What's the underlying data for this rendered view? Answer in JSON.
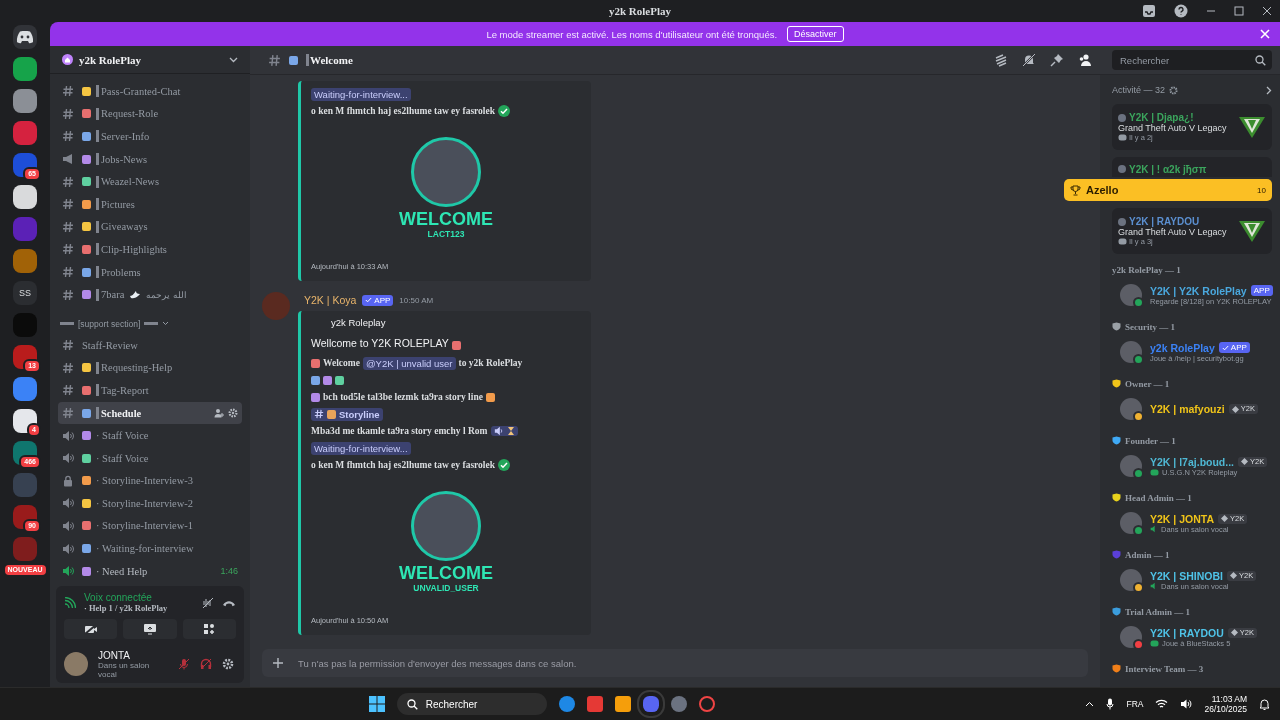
{
  "window": {
    "title": "y2k RolePlay"
  },
  "servers": [
    {
      "kind": "home"
    },
    {
      "kind": "server",
      "color": "#16a34a"
    },
    {
      "kind": "server",
      "color": "#8b8f96"
    },
    {
      "kind": "server",
      "color": "#d5223f"
    },
    {
      "kind": "server",
      "color": "#1d4ed8",
      "badge": "65"
    },
    {
      "kind": "server",
      "color": "#d9dadc"
    },
    {
      "kind": "server",
      "color": "#5b21b6"
    },
    {
      "kind": "server",
      "color": "#a16207"
    },
    {
      "kind": "server",
      "color": "#2b2d31",
      "label": "SS"
    },
    {
      "kind": "server",
      "color": "#0b0b0b"
    },
    {
      "kind": "server",
      "color": "#b91c1c",
      "badge": "13"
    },
    {
      "kind": "server",
      "color": "#3b82f6"
    },
    {
      "kind": "server",
      "color": "#e5e7eb",
      "badge": "4"
    },
    {
      "kind": "server",
      "color": "#0f766e",
      "badge": "466"
    },
    {
      "kind": "server",
      "color": "#374151"
    },
    {
      "kind": "server",
      "color": "#991b1b",
      "badge": "90"
    },
    {
      "kind": "server",
      "color": "#7f1d1d",
      "badge": "NOUVEAU"
    }
  ],
  "banner": {
    "text": "Le mode streamer est activé. Les noms d'utilisateur ont été tronqués.",
    "button": "Désactiver"
  },
  "server_header": {
    "name": "y2k RolePlay"
  },
  "channels": [
    {
      "kind": "text",
      "name": "Pass-Granted-Chat",
      "selected": false
    },
    {
      "kind": "text",
      "name": "Request-Role",
      "selected": false
    },
    {
      "kind": "text",
      "name": "Server-Info",
      "selected": false
    },
    {
      "kind": "announce",
      "name": "Jobs-News",
      "selected": false
    },
    {
      "kind": "text",
      "name": "Weazel-News",
      "selected": false
    },
    {
      "kind": "text",
      "name": "Pictures",
      "selected": false
    },
    {
      "kind": "text",
      "name": "Giveaways",
      "selected": false
    },
    {
      "kind": "text",
      "name": "Clip-Highlights",
      "selected": false
    },
    {
      "kind": "text",
      "name": "Problems",
      "selected": false
    },
    {
      "kind": "text",
      "name": "7bara",
      "suffix": "الله يرحمه",
      "selected": false
    },
    {
      "kind": "category",
      "name": "[support section]"
    },
    {
      "kind": "plain",
      "name": "Staff-Review",
      "selected": false
    },
    {
      "kind": "text",
      "name": "Requesting-Help",
      "selected": false
    },
    {
      "kind": "text",
      "name": "Tag-Report",
      "selected": false
    },
    {
      "kind": "text",
      "name": "Schedule",
      "selected": true
    },
    {
      "kind": "voice",
      "name": "· Staff Voice",
      "selected": false
    },
    {
      "kind": "voice",
      "name": "· Staff Voice",
      "selected": false
    },
    {
      "kind": "locked",
      "name": "· Storyline-Interview-3",
      "selected": false
    },
    {
      "kind": "voice",
      "name": "· Storyline-Interview-2",
      "selected": false
    },
    {
      "kind": "voice",
      "name": "· Storyline-Interview-1",
      "selected": false
    },
    {
      "kind": "voice",
      "name": "· Waiting-for-interview",
      "selected": false
    },
    {
      "kind": "voice-live",
      "name": "· Need Help",
      "timer": "1:46",
      "selected": false
    }
  ],
  "voice_panel": {
    "status": "Voix connectée",
    "channel": "· Help 1 / y2k RolePlay"
  },
  "user_panel": {
    "name": "JONTA",
    "status": "Dans un salon vocal"
  },
  "chat_header": {
    "channel": "Welcome",
    "search_placeholder": "Rechercher"
  },
  "messages": [
    {
      "embed": {
        "lines": [
          [
            {
              "kind": "chip",
              "text": "Waiting-for-interview..."
            }
          ],
          [
            {
              "kind": "text",
              "text": "o ken M fhmtch haj es2lhume taw ey fasrolek"
            },
            {
              "kind": "check"
            }
          ]
        ],
        "image": {
          "title": "WELCOME",
          "subtitle": "LACT123"
        },
        "timestamp": "Aujourd'hui à 10:33 AM"
      }
    },
    {
      "author": "Y2K | Koya",
      "badge": "APP",
      "time": "10:50 AM",
      "embed": {
        "author": "y2k Roleplay",
        "lines": [
          [
            {
              "kind": "title",
              "text": "Wellcome to Y2K ROLEPLAY"
            },
            {
              "kind": "emoji"
            }
          ],
          [
            {
              "kind": "emoji"
            },
            {
              "kind": "text",
              "text": "Welcome"
            },
            {
              "kind": "chip",
              "text": "@Y2K | unvalid user"
            },
            {
              "kind": "text",
              "text": "to y2k RolePlay"
            }
          ],
          [
            {
              "kind": "emoji"
            },
            {
              "kind": "emoji"
            },
            {
              "kind": "emoji"
            }
          ],
          [
            {
              "kind": "emoji"
            },
            {
              "kind": "text",
              "text": "bch tod5le tal3be lezmk ta9ra story line"
            },
            {
              "kind": "emoji"
            }
          ],
          [
            {
              "kind": "channel",
              "text": "Storyline"
            }
          ],
          [
            {
              "kind": "text",
              "text": "Mba3d me tkamle ta9ra story emchy l Rom"
            },
            {
              "kind": "voice-chip"
            }
          ],
          [
            {
              "kind": "chip",
              "text": "Waiting-for-interview..."
            }
          ],
          [
            {
              "kind": "text",
              "text": "o ken M fhmtch haj es2lhume taw ey fasrolek"
            },
            {
              "kind": "check"
            }
          ]
        ],
        "image": {
          "title": "WELCOME",
          "subtitle": "UNVALID_USER"
        },
        "timestamp": "Aujourd'hui à 10:50 AM"
      }
    }
  ],
  "composer": {
    "placeholder": "Tu n'as pas la permission d'envoyer des messages dans ce salon."
  },
  "members": {
    "activity_title": "Activité — 32",
    "activities": [
      {
        "user": "Y2K | Djapa¿!",
        "color": "#3ba55d",
        "game": "Grand Theft Auto V Legacy",
        "time": "Il y a 2j"
      },
      {
        "user": "Y2K | ! α2k jђσπ",
        "color": "#3ba55d"
      },
      {
        "user": "Y2K | RAYDOU",
        "color": "#5b8fd0",
        "game": "Grand Theft Auto V Legacy",
        "time": "Il y a 3j"
      }
    ],
    "groups": [
      {
        "name": "y2k RolePlay — 1",
        "members": [
          {
            "name": "Y2K | Y2K RolePlay",
            "color": "#4aa8de",
            "badge": {
              "kind": "app",
              "text": "APP"
            },
            "status": {
              "kind": "plain",
              "text": "Regarde [8/128] on Y2K ROLEPLAY"
            },
            "presence": {
              "color": "#23a55a"
            }
          }
        ]
      },
      {
        "name": "Security — 1",
        "color": "#9aa0a6",
        "members": [
          {
            "name": "y2k RolePlay",
            "color": "#3b82f6",
            "badge": {
              "kind": "verified",
              "text": "APP"
            },
            "status": {
              "kind": "plain",
              "text": "Joue à /help | securitybot.gg"
            },
            "presence": {
              "color": "#23a55a"
            }
          }
        ]
      },
      {
        "name": "Owner — 1",
        "color": "#f0c419",
        "members": [
          {
            "name": "Y2K | mafyouzi",
            "color": "#f0c419",
            "badge": {
              "kind": "tag",
              "text": "Y2K"
            },
            "presence": {
              "color": "#f0b232"
            }
          }
        ]
      },
      {
        "name": "Founder — 1",
        "color": "#3fa9f5",
        "members": [
          {
            "name": "Y2K | l7aj.boud...",
            "color": "#4fb8d4",
            "badge": {
              "kind": "tag",
              "text": "Y2K"
            },
            "status": {
              "kind": "game",
              "text": "U.S.G.N Y2K Roleplay"
            },
            "presence": {
              "color": "#23a55a"
            }
          }
        ]
      },
      {
        "name": "Head Admin — 1",
        "color": "#e8d21c",
        "members": [
          {
            "name": "Y2K | JONTA",
            "color": "#f0c419",
            "badge": {
              "kind": "tag",
              "text": "Y2K"
            },
            "status": {
              "kind": "voice",
              "text": "Dans un salon vocal"
            },
            "presence": {
              "color": "#23a55a"
            }
          }
        ]
      },
      {
        "name": "Admin — 1",
        "color": "#5b3fd8",
        "members": [
          {
            "name": "Y2K | SHINOBI",
            "color": "#4fc3e8",
            "badge": {
              "kind": "tag",
              "text": "Y2K"
            },
            "status": {
              "kind": "voice",
              "text": "Dans un salon vocal"
            },
            "presence": {
              "color": "#f0b232"
            }
          }
        ]
      },
      {
        "name": "Trial Admin — 1",
        "color": "#3b9ddd",
        "members": [
          {
            "name": "Y2K | RAYDOU",
            "color": "#4fc3e8",
            "badge": {
              "kind": "tag",
              "text": "Y2K"
            },
            "status": {
              "kind": "game",
              "text": "Joue à BlueStacks 5"
            },
            "presence": {
              "color": "#f23f43"
            }
          }
        ]
      },
      {
        "name": "Interview Team — 3",
        "color": "#f07f19"
      }
    ]
  },
  "alert": {
    "name": "Azello",
    "count": "10"
  },
  "taskbar": {
    "search": "Rechercher",
    "language": "FRA",
    "time": "11:03 AM",
    "date": "26/10/2025"
  }
}
